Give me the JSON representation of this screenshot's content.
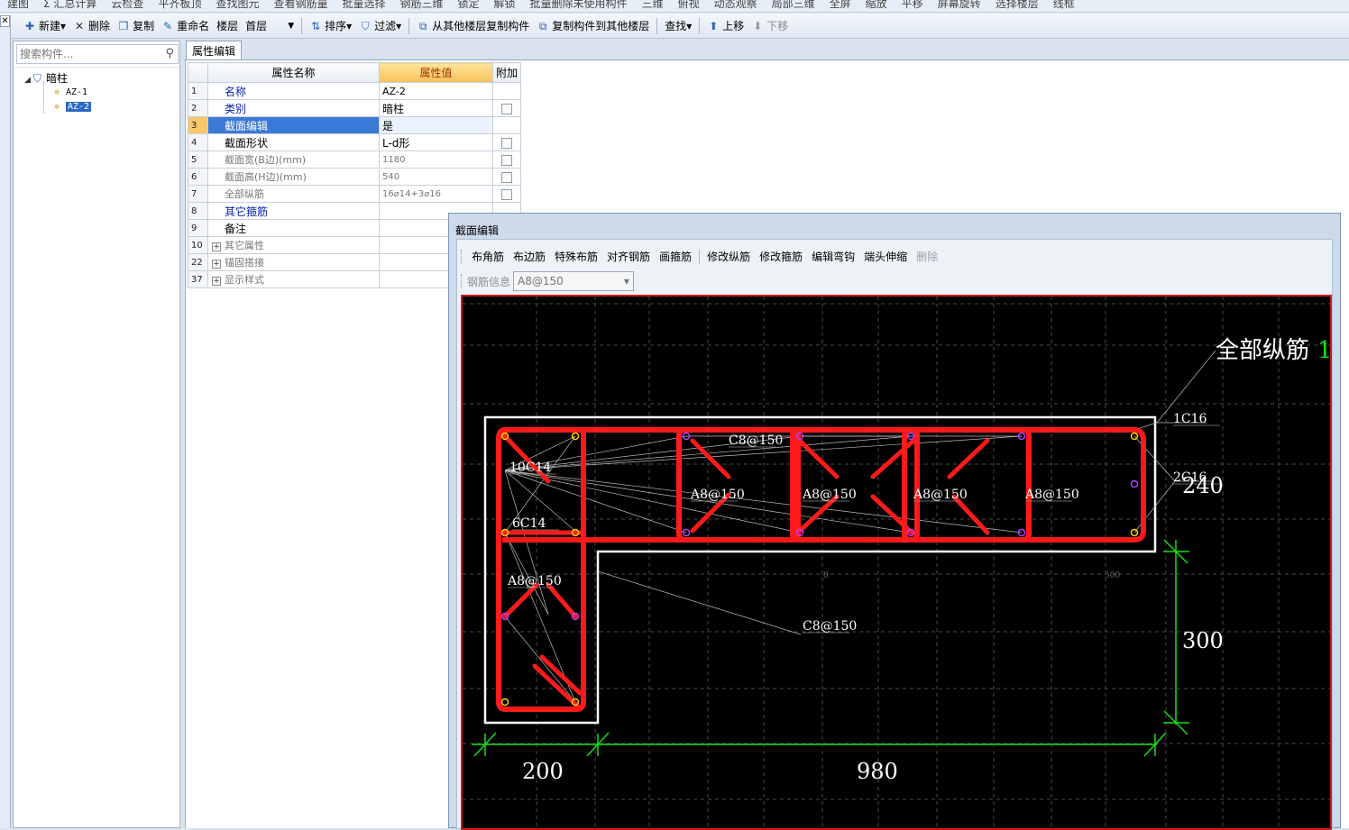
{
  "top_strip": [
    "建图",
    "Σ 汇总计算",
    "云检查",
    "平齐板顶",
    "查找图元",
    "查看钢筋量",
    "批量选择",
    "钢筋三维",
    "锁定",
    "解锁",
    "批量删除未使用构件",
    "三维",
    "俯视",
    "动态观察",
    "局部三维",
    "全屏",
    "缩放",
    "平移",
    "屏幕旋转",
    "选择楼层",
    "线框"
  ],
  "toolbar": {
    "new": "新建",
    "delete": "删除",
    "copy": "复制",
    "rename": "重命名",
    "floor_label": "楼层",
    "floor_value": "首层",
    "sort": "排序",
    "filter": "过滤",
    "copy_from_floor": "从其他楼层复制构件",
    "copy_to_floor": "复制构件到其他楼层",
    "find": "查找",
    "move_up": "上移",
    "move_down": "下移"
  },
  "left_panel": {
    "search_placeholder": "搜索构件...",
    "tree_root": "暗柱",
    "tree_items": [
      "AZ-1",
      "AZ-2"
    ],
    "selected_item": "AZ-2"
  },
  "property_editor": {
    "tab": "属性编辑",
    "headers": {
      "name": "属性名称",
      "value": "属性值",
      "extra": "附加"
    },
    "rows": [
      {
        "num": "1",
        "name": "名称",
        "value": "AZ-2",
        "checkbox": false
      },
      {
        "num": "2",
        "name": "类别",
        "value": "暗柱",
        "checkbox": true
      },
      {
        "num": "3",
        "name": "截面编辑",
        "value": "是",
        "checkbox": false
      },
      {
        "num": "4",
        "name": "截面形状",
        "value": "L-d形",
        "checkbox": true
      },
      {
        "num": "5",
        "name": "截面宽(B边)(mm)",
        "value": "1180",
        "checkbox": true
      },
      {
        "num": "6",
        "name": "截面高(H边)(mm)",
        "value": "540",
        "checkbox": true
      },
      {
        "num": "7",
        "name": "全部纵筋",
        "value": "16⌀14+3⌀16",
        "checkbox": true
      },
      {
        "num": "8",
        "name": "其它箍筋",
        "value": "",
        "checkbox": false
      },
      {
        "num": "9",
        "name": "备注",
        "value": "",
        "checkbox": true
      },
      {
        "num": "10",
        "name": "其它属性",
        "value": "",
        "checkbox": false
      },
      {
        "num": "22",
        "name": "锚固搭接",
        "value": "",
        "checkbox": false
      },
      {
        "num": "37",
        "name": "显示样式",
        "value": "",
        "checkbox": false
      }
    ]
  },
  "section_editor": {
    "title": "截面编辑",
    "toolbar": [
      "布角筋",
      "布边筋",
      "特殊布筋",
      "对齐钢筋",
      "画箍筋",
      "修改纵筋",
      "修改箍筋",
      "编辑弯钩",
      "端头伸缩",
      "删除"
    ],
    "rebar_info_label": "钢筋信息",
    "rebar_info_value": "A8@150",
    "drawing": {
      "all_longitudinal_label": "全部纵筋",
      "all_longitudinal_suffix": "1",
      "labels": [
        "1C16",
        "2C16",
        "10C14",
        "6C14",
        "C8@150",
        "A8@150",
        "A8@150",
        "A8@150",
        "A8@150",
        "A8@150",
        "C8@150"
      ],
      "axis_ticks": [
        "0",
        "500"
      ],
      "dims": {
        "bottom_left": "200",
        "bottom_right": "980",
        "right_top": "240",
        "right_bottom": "300"
      }
    },
    "colors": {
      "rebar": "#ff1a1a",
      "dimension": "#14e014",
      "outline": "#ffffff",
      "background": "#000000"
    }
  }
}
